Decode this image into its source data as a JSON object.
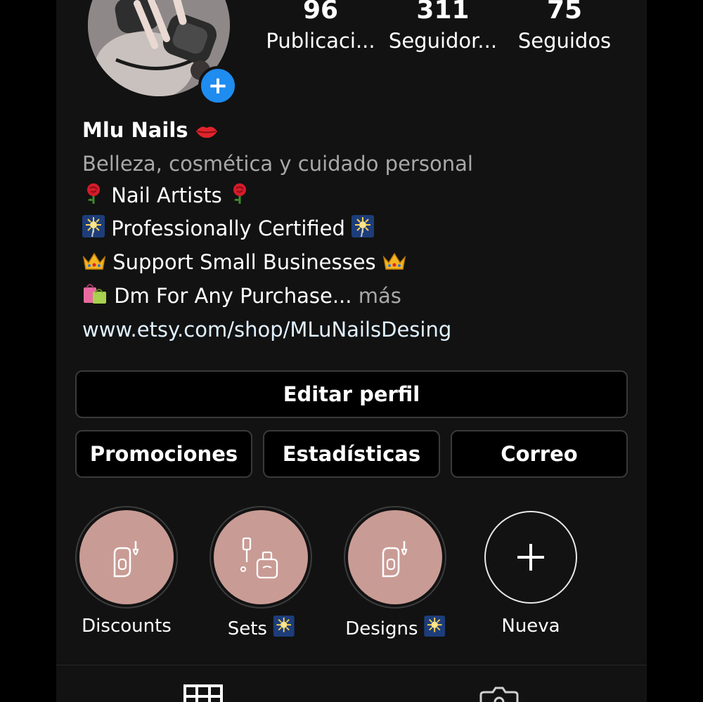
{
  "profile": {
    "posts": {
      "count": "96",
      "label": "Publicaci..."
    },
    "followers": {
      "count": "311",
      "label": "Seguidor..."
    },
    "following": {
      "count": "75",
      "label": "Seguidos"
    },
    "name": "Mlu Nails",
    "name_emoji": "lips",
    "category": "Belleza, cosmética y cuidado personal",
    "bio_lines": [
      {
        "text": "Nail Artists",
        "emoji": "rose"
      },
      {
        "text": "Professionally Certified",
        "emoji": "sparkler"
      },
      {
        "text": "Support Small Businesses",
        "emoji": "crown"
      },
      {
        "text": "Dm For Any Purchase...",
        "emoji": "shopping-bags",
        "more": "más"
      }
    ],
    "link": "www.etsy.com/shop/MLuNailsDesing"
  },
  "buttons": {
    "edit_profile": "Editar perfil",
    "promotions": "Promociones",
    "insights": "Estadísticas",
    "email": "Correo"
  },
  "highlights": [
    {
      "label": "Discounts",
      "icon": "nail-polish-hand-icon"
    },
    {
      "label": "Sets",
      "icon": "nail-polish-bottle-icon",
      "emoji": "sparkler"
    },
    {
      "label": "Designs",
      "icon": "nail-polish-hand-icon",
      "emoji": "sparkler"
    },
    {
      "label": "Nueva",
      "icon": "plus-icon"
    }
  ],
  "tabs": [
    {
      "icon": "grid-icon"
    },
    {
      "icon": "tagged-icon"
    }
  ],
  "colors": {
    "background": "#121212",
    "accent_blue": "#1f8cf0",
    "highlight_cover": "#c99b95",
    "muted_text": "#a8a8a8"
  }
}
